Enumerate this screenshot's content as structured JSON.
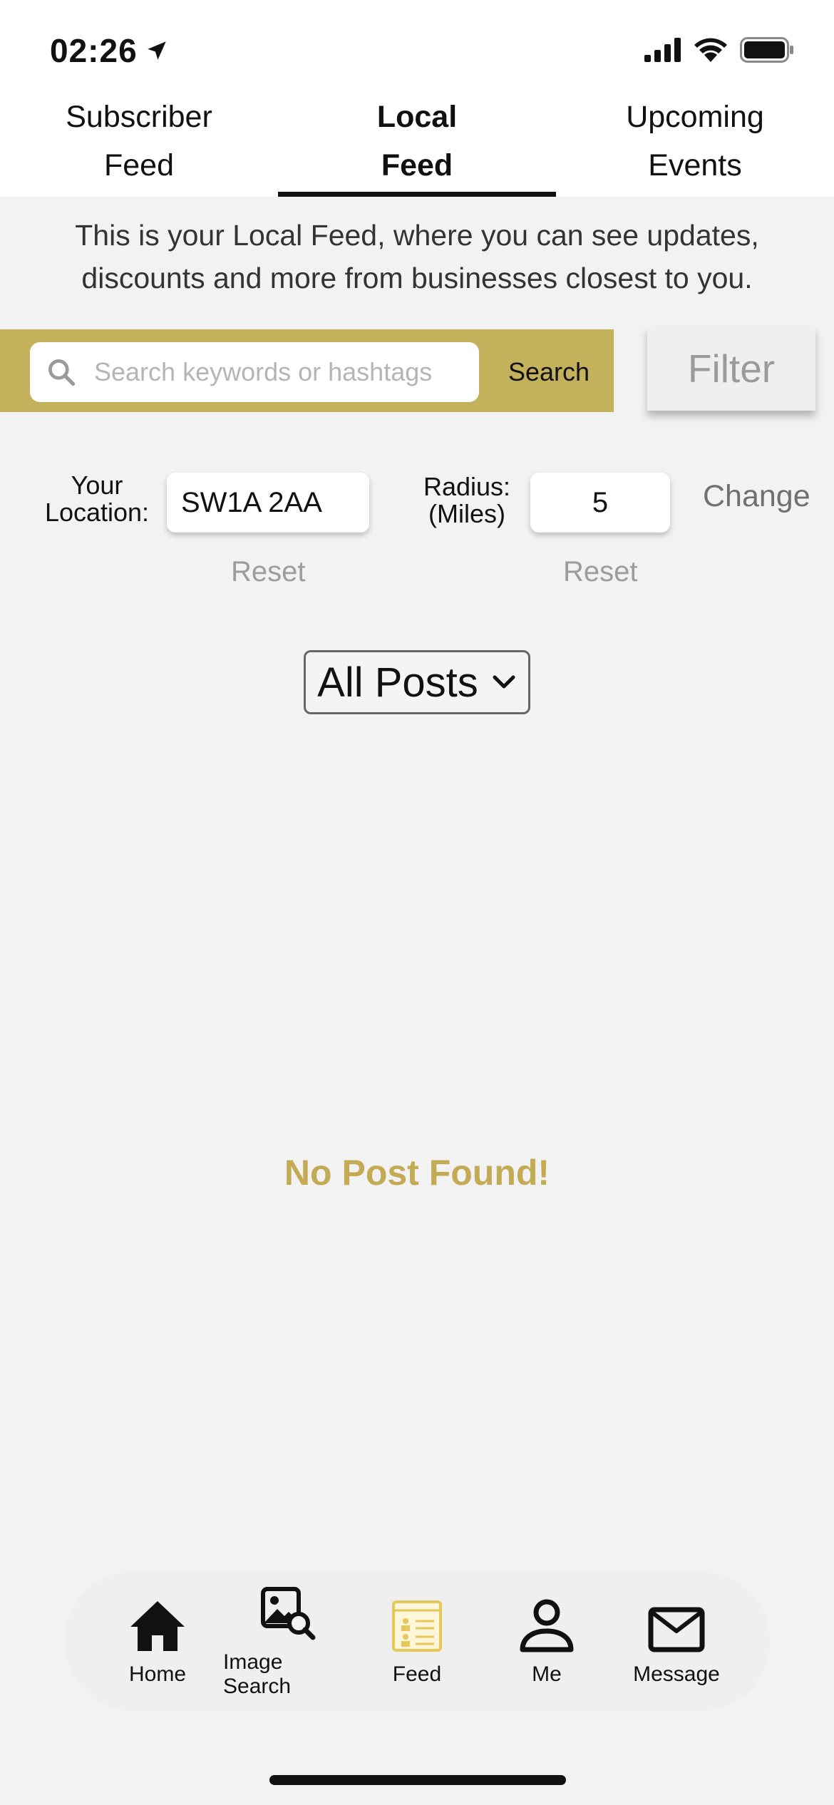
{
  "status_bar": {
    "time": "02:26"
  },
  "tabs": [
    {
      "line1": "Subscriber",
      "line2": "Feed"
    },
    {
      "line1": "Local",
      "line2": "Feed"
    },
    {
      "line1": "Upcoming",
      "line2": "Events"
    }
  ],
  "description": "This is your Local Feed, where you can see updates, discounts and more from businesses closest to you.",
  "search": {
    "placeholder": "Search keywords or hashtags",
    "button_label": "Search"
  },
  "filter_label": "Filter",
  "location": {
    "label": "Your Location:",
    "value": "SW1A 2AA",
    "radius_label": "Radius: (Miles)",
    "radius_value": "5",
    "change_label": "Change",
    "reset_label": "Reset"
  },
  "post_filter": {
    "selected": "All Posts"
  },
  "empty_message": "No Post Found!",
  "bottom_nav": [
    {
      "label": "Home",
      "icon": "home-icon"
    },
    {
      "label": "Image Search",
      "icon": "image-search-icon"
    },
    {
      "label": "Feed",
      "icon": "feed-icon"
    },
    {
      "label": "Me",
      "icon": "person-icon"
    },
    {
      "label": "Message",
      "icon": "mail-icon"
    }
  ],
  "colors": {
    "accent": "#c3b15b",
    "empty_text": "#c3aa55"
  }
}
